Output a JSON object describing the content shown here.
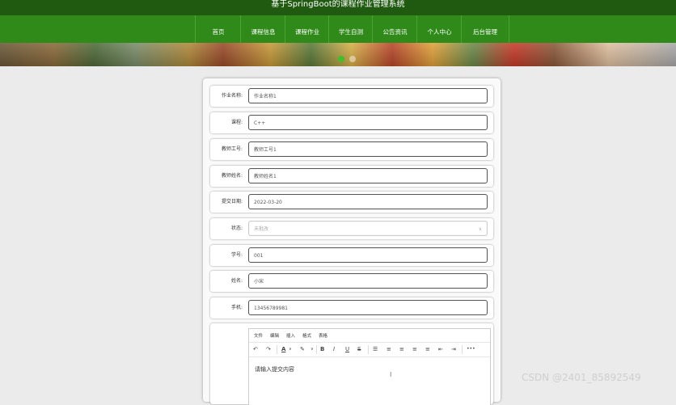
{
  "app_title": "基于SpringBoot的课程作业管理系统",
  "nav": {
    "items": [
      {
        "label": "首页"
      },
      {
        "label": "课程信息"
      },
      {
        "label": "课程作业"
      },
      {
        "label": "学生自测"
      },
      {
        "label": "公告资讯"
      },
      {
        "label": "个人中心"
      },
      {
        "label": "后台管理"
      }
    ]
  },
  "form": {
    "fields": [
      {
        "label": "作业名称:",
        "value": "作业名称1"
      },
      {
        "label": "课程:",
        "value": "C++"
      },
      {
        "label": "教师工号:",
        "value": "教师工号1"
      },
      {
        "label": "教师姓名:",
        "value": "教师姓名1"
      },
      {
        "label": "提交日期:",
        "value": "2022-03-20"
      },
      {
        "label": "状态:",
        "value": "未批改"
      },
      {
        "label": "学号:",
        "value": "001"
      },
      {
        "label": "姓名:",
        "value": "小宋"
      },
      {
        "label": "手机:",
        "value": "13456789981"
      }
    ],
    "editor": {
      "menu": [
        "文件",
        "编辑",
        "插入",
        "格式",
        "表格"
      ],
      "toolbar": {
        "undo": "↶",
        "redo": "↷",
        "font_color": "A",
        "highlight": "✎",
        "bold": "B",
        "italic": "I",
        "underline": "U",
        "strike": "S",
        "ordered_list": "☰",
        "align_left": "≡",
        "align_center": "≡",
        "align_right": "≡",
        "align_justify": "≡",
        "outdent": "⇤",
        "indent": "⇥",
        "more": "•••",
        "dropdown": "∨"
      },
      "placeholder": "请输入提交内容"
    }
  },
  "watermark": "CSDN @2401_85892549",
  "colors": {
    "topbar": "#1f5a10",
    "nav": "#2f8a1a",
    "page_bg": "#ebebeb"
  }
}
